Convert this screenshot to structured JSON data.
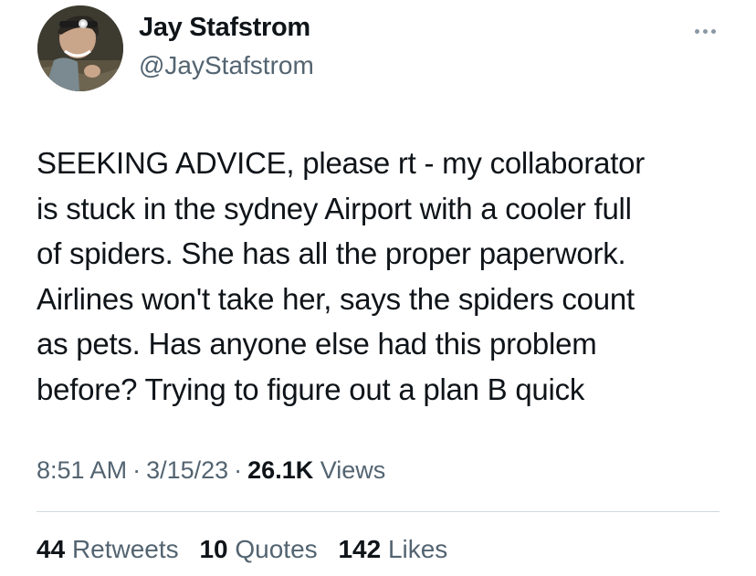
{
  "author": {
    "name": "Jay Stafstrom",
    "handle": "@JayStafstrom",
    "avatar_icon": "profile-photo-headlamp"
  },
  "more_icon": "ellipsis-icon",
  "tweet": {
    "text": "SEEKING ADVICE, please rt - my collaborator\nis stuck in the sydney Airport with a cooler full\nof spiders. She has all the proper paperwork.\nAirlines won't take her, says the spiders count\nas pets. Has anyone else had this problem\nbefore? Trying to figure out a plan B quick",
    "time": "8:51 AM",
    "date": "3/15/23",
    "separator": "·",
    "views_count": "26.1K",
    "views_label": "Views"
  },
  "stats": {
    "retweets_count": "44",
    "retweets_label": "Retweets",
    "quotes_count": "10",
    "quotes_label": "Quotes",
    "likes_count": "142",
    "likes_label": "Likes"
  },
  "colors": {
    "text": "#0f1419",
    "secondary": "#536471",
    "divider": "#cfd9de"
  }
}
